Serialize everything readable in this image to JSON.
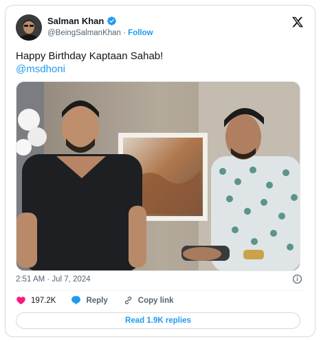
{
  "tweet": {
    "author_name": "Salman Khan",
    "author_handle": "@BeingSalmanKhan",
    "separator": " · ",
    "follow_label": "Follow",
    "text_line1": "Happy Birthday Kaptaan Sahab!",
    "mention": "@msdhoni",
    "timestamp": "2:51 AM · Jul 7, 2024",
    "likes_count": "197.2K",
    "reply_label": "Reply",
    "copy_link_label": "Copy link",
    "read_replies_label": "Read 1.9K replies"
  },
  "icons": {
    "verified": "verified-badge-icon",
    "brand": "x-logo-icon",
    "info": "info-icon",
    "like": "heart-icon",
    "reply": "reply-bubble-icon",
    "copy": "link-icon"
  },
  "colors": {
    "accent": "#1d9bf0",
    "like": "#f91880",
    "text": "#0f1419",
    "muted": "#536471",
    "border": "#cfd9de"
  }
}
